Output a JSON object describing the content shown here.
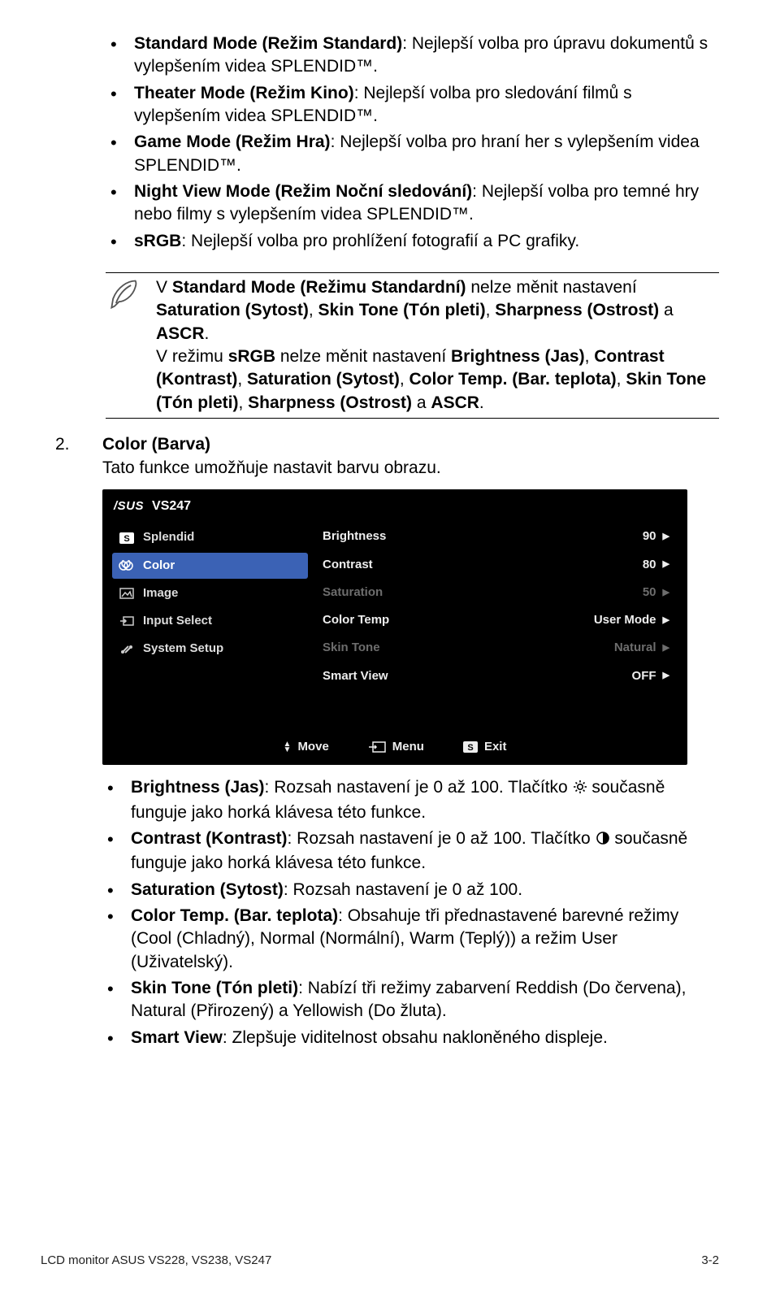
{
  "top_list": [
    {
      "bold": "Standard Mode (Režim Standard)",
      "rest": ": Nejlepší volba pro úpravu dokumentů s vylepšením videa SPLENDID™."
    },
    {
      "bold": "Theater Mode (Režim Kino)",
      "rest": ": Nejlepší volba pro sledování filmů s vylepšením videa SPLENDID™."
    },
    {
      "bold": "Game Mode (Režim Hra)",
      "rest": ": Nejlepší volba pro hraní her s vylepšením videa SPLENDID™."
    },
    {
      "bold": "Night View Mode (Režim Noční sledování)",
      "rest": ": Nejlepší volba pro temné hry nebo filmy s vylepšením videa SPLENDID™."
    },
    {
      "bold": "sRGB",
      "rest": ": Nejlepší volba pro prohlížení fotografií a PC grafiky."
    }
  ],
  "note": {
    "p1_pre": "V ",
    "p1_b1": "Standard Mode (Režimu Standardní)",
    "p1_mid": " nelze měnit nastavení ",
    "p1_b2": "Saturation (Sytost)",
    "p1_c1": ", ",
    "p1_b3": "Skin Tone (Tón pleti)",
    "p1_c2": ", ",
    "p1_b4": "Sharpness (Ostrost)",
    "p1_c3": " a ",
    "p1_b5": "ASCR",
    "p1_end": ".",
    "p2_pre": "V režimu ",
    "p2_b1": "sRGB",
    "p2_mid": " nelze měnit nastavení ",
    "p2_b2": "Brightness (Jas)",
    "p2_c1": ", ",
    "p2_b3": "Contrast (Kontrast)",
    "p2_c2": ", ",
    "p2_b4": "Saturation (Sytost)",
    "p2_c3": ", ",
    "p2_b5": "Color Temp. (Bar. teplota)",
    "p2_c4": ", ",
    "p2_b6": "Skin Tone (Tón pleti)",
    "p2_c5": ", ",
    "p2_b7": "Sharpness (Ostrost)",
    "p2_c6": " a ",
    "p2_b8": "ASCR",
    "p2_end": "."
  },
  "section": {
    "num": "2.",
    "title": "Color (Barva)",
    "desc": "Tato funkce umožňuje nastavit barvu obrazu."
  },
  "osd": {
    "model": "VS247",
    "left": [
      {
        "icon": "S",
        "label": "Splendid"
      },
      {
        "icon": "rgb",
        "label": "Color"
      },
      {
        "icon": "img",
        "label": "Image"
      },
      {
        "icon": "input",
        "label": "Input Select"
      },
      {
        "icon": "tools",
        "label": "System Setup"
      }
    ],
    "selected_index": 1,
    "right": [
      {
        "label": "Brightness",
        "value": "90",
        "dim": false
      },
      {
        "label": "Contrast",
        "value": "80",
        "dim": false
      },
      {
        "label": "Saturation",
        "value": "50",
        "dim": true
      },
      {
        "label": "Color Temp",
        "value": "User Mode",
        "dim": false
      },
      {
        "label": "Skin Tone",
        "value": "Natural",
        "dim": true
      },
      {
        "label": "Smart View",
        "value": "OFF",
        "dim": false
      }
    ],
    "footer": {
      "move": "Move",
      "menu": "Menu",
      "exit": "Exit"
    }
  },
  "second_list": {
    "i0_b": "Brightness (Jas)",
    "i0_t1": ": Rozsah nastavení je 0 až 100. Tlačítko ",
    "i0_t2": " současně funguje jako horká klávesa této funkce.",
    "i1_b": "Contrast (Kontrast)",
    "i1_t1": ": Rozsah nastavení je 0 až 100. Tlačítko ",
    "i1_t2": " současně funguje jako horká klávesa této funkce.",
    "i2_b": "Saturation (Sytost)",
    "i2_t": ": Rozsah nastavení je 0 až 100.",
    "i3_b": "Color Temp. (Bar. teplota)",
    "i3_t": ": Obsahuje tři přednastavené barevné režimy (Cool (Chladný), Normal (Normální), Warm (Teplý)) a režim User (Uživatelský).",
    "i4_b": "Skin Tone (Tón pleti)",
    "i4_t": ": Nabízí tři režimy zabarvení Reddish (Do červena), Natural (Přirozený) a Yellowish (Do žluta).",
    "i5_b": "Smart View",
    "i5_t": ": Zlepšuje viditelnost obsahu nakloněného displeje."
  },
  "footer": {
    "left": "LCD monitor ASUS VS228, VS238, VS247",
    "right": "3-2"
  }
}
